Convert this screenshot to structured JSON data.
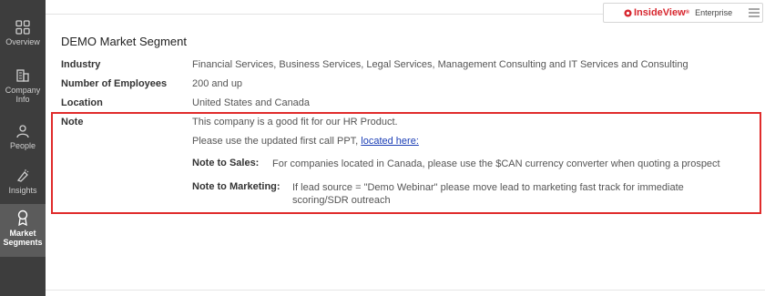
{
  "sidebar": {
    "items": [
      {
        "label": "Overview",
        "icon": "grid-icon"
      },
      {
        "label": "Company Info",
        "icon": "building-icon"
      },
      {
        "label": "People",
        "icon": "people-icon"
      },
      {
        "label": "Insights",
        "icon": "lightbulb-icon"
      },
      {
        "label": "Market Segments",
        "icon": "segment-icon",
        "active": true
      }
    ]
  },
  "header": {
    "brand": "InsideView",
    "trademark": "®",
    "edition": "Enterprise",
    "menu_icon": "hamburger-icon"
  },
  "page": {
    "title": "DEMO Market Segment",
    "fields": [
      {
        "label": "Industry",
        "value": "Financial Services, Business Services, Legal Services, Management Consulting and IT Services and Consulting"
      },
      {
        "label": "Number of Employees",
        "value": "200 and up"
      },
      {
        "label": "Location",
        "value": "United States and Canada"
      }
    ],
    "note": {
      "label": "Note",
      "line1": "This company is a good fit for our HR Product.",
      "line2_prefix": "Please use the updated first call PPT, ",
      "line2_link": "located here:",
      "sales_label": "Note to Sales:",
      "sales_value": "For companies located in Canada, please use the $CAN currency converter when quoting a prospect",
      "marketing_label": "Note to Marketing:",
      "marketing_value_line1": "If lead source = \"Demo Webinar\" please move lead to marketing fast track for immediate",
      "marketing_value_line2": "scoring/SDR outreach"
    }
  },
  "colors": {
    "sidebar_bg": "#3d3d3d",
    "sidebar_active": "#5b5b5b",
    "brand_red": "#d7262e",
    "highlight_border": "#e02b2b",
    "link": "#1a3db5"
  }
}
